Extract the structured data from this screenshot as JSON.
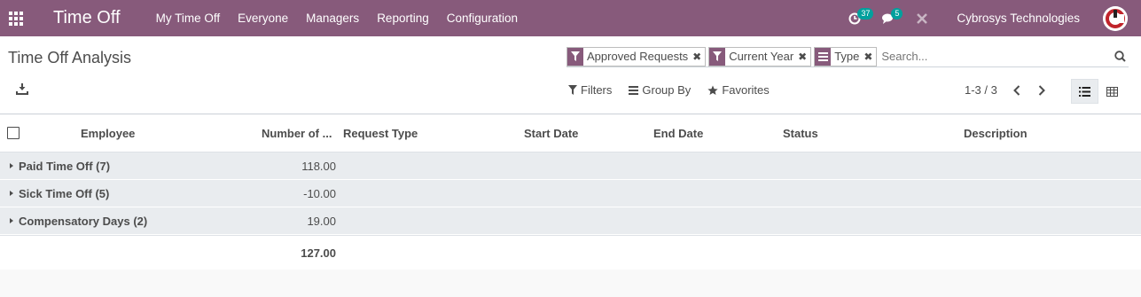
{
  "navbar": {
    "app_title": "Time Off",
    "menu": [
      "My Time Off",
      "Everyone",
      "Managers",
      "Reporting",
      "Configuration"
    ],
    "activity_count": "37",
    "message_count": "5",
    "company": "Cybrosys Technologies",
    "color": "#875a7b"
  },
  "control_panel": {
    "breadcrumb": "Time Off Analysis",
    "facets": [
      {
        "icon": "filter-icon",
        "value": "Approved Requests"
      },
      {
        "icon": "filter-icon",
        "value": "Current Year"
      },
      {
        "icon": "group-by-icon",
        "value": "Type"
      }
    ],
    "search_placeholder": "Search...",
    "filters_label": "Filters",
    "groupby_label": "Group By",
    "favorites_label": "Favorites",
    "pager": "1-3 / 3"
  },
  "table": {
    "columns": [
      "Employee",
      "Number of ...",
      "Request Type",
      "Start Date",
      "End Date",
      "Status",
      "Description"
    ],
    "groups": [
      {
        "name": "Paid Time Off (7)",
        "value": "118.00"
      },
      {
        "name": "Sick Time Off (5)",
        "value": "-10.00"
      },
      {
        "name": "Compensatory Days (2)",
        "value": "19.00"
      }
    ],
    "total": "127.00"
  }
}
